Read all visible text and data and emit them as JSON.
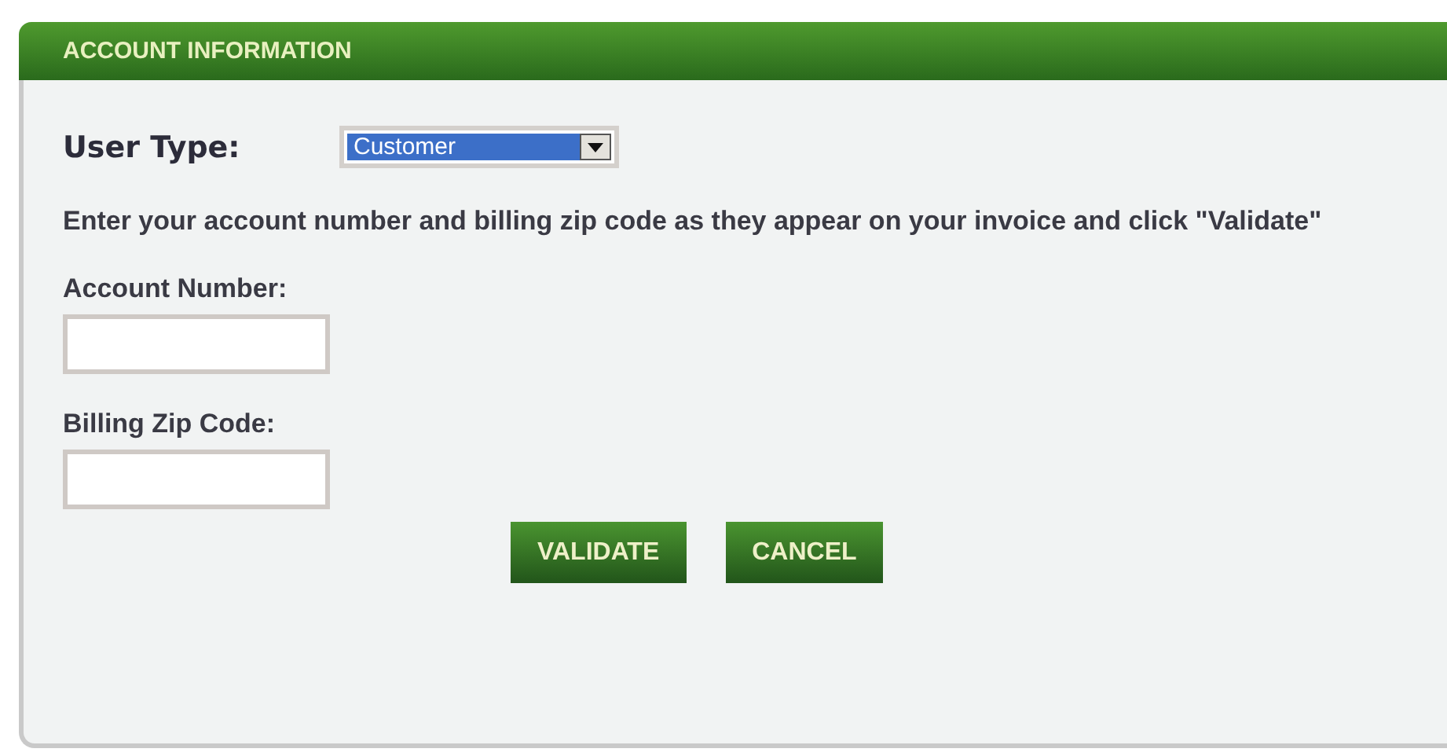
{
  "panel": {
    "title": "ACCOUNT INFORMATION"
  },
  "user_type": {
    "label": "User Type:",
    "value": "Customer"
  },
  "instructions": "Enter your account number and billing zip code as they appear on your invoice and click \"Validate\"",
  "fields": [
    {
      "label": "Account Number:"
    },
    {
      "label": "Billing Zip Code:"
    }
  ],
  "buttons": [
    "VALIDATE",
    "CANCEL"
  ]
}
